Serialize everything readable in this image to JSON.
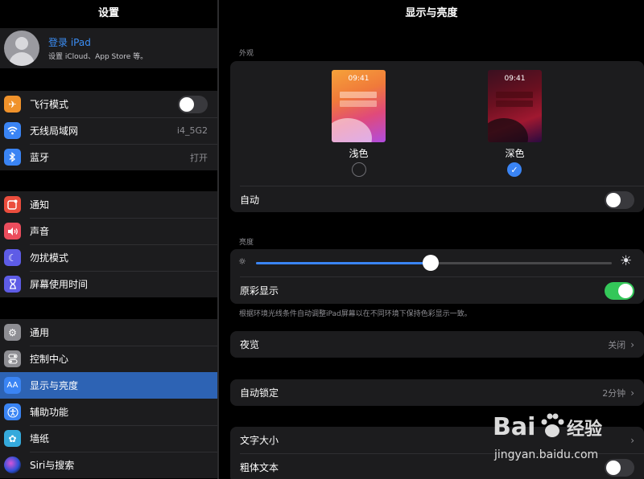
{
  "sidebar": {
    "title": "设置",
    "profile": {
      "name": "登录 iPad",
      "subtitle": "设置 iCloud、App Store 等。"
    },
    "groups": [
      {
        "items": [
          {
            "label": "飞行模式",
            "icon": "airplane-icon",
            "color": "#f0922b",
            "glyph": "✈",
            "toggle": "off"
          },
          {
            "label": "无线局域网",
            "icon": "wifi-icon",
            "color": "#3a84f4",
            "glyph": "◠",
            "value": "i4_5G2"
          },
          {
            "label": "蓝牙",
            "icon": "bluetooth-icon",
            "color": "#3a84f4",
            "glyph": "ᛒ",
            "value": "打开"
          }
        ]
      },
      {
        "items": [
          {
            "label": "通知",
            "icon": "notifications-icon",
            "color": "#eb4d3d",
            "glyph": "◘"
          },
          {
            "label": "声音",
            "icon": "sound-icon",
            "color": "#eb4d5d",
            "glyph": "🔊"
          },
          {
            "label": "勿扰模式",
            "icon": "moon-icon",
            "color": "#5e5ce6",
            "glyph": "☾"
          },
          {
            "label": "屏幕使用时间",
            "icon": "hourglass-icon",
            "color": "#5e5ce6",
            "glyph": "⧗"
          }
        ]
      },
      {
        "items": [
          {
            "label": "通用",
            "icon": "gear-icon",
            "color": "#8e8e93",
            "glyph": "⚙"
          },
          {
            "label": "控制中心",
            "icon": "control-center-icon",
            "color": "#8e8e93",
            "glyph": "◉"
          },
          {
            "label": "显示与亮度",
            "icon": "display-icon",
            "color": "#3a84f4",
            "glyph": "AA",
            "selected": true
          },
          {
            "label": "辅助功能",
            "icon": "accessibility-icon",
            "color": "#3a84f4",
            "glyph": "♿"
          },
          {
            "label": "墙纸",
            "icon": "wallpaper-icon",
            "color": "#35aadc",
            "glyph": "✿"
          },
          {
            "label": "Siri与搜索",
            "icon": "siri-icon",
            "color": "#333344",
            "glyph": "◍"
          }
        ]
      }
    ]
  },
  "main": {
    "title": "显示与亮度",
    "appearance": {
      "section_label": "外观",
      "light": {
        "time": "09:41",
        "label": "浅色",
        "selected": false
      },
      "dark": {
        "time": "09:41",
        "label": "深色",
        "selected": true
      },
      "auto_label": "自动",
      "auto_on": false
    },
    "brightness": {
      "section_label": "亮度",
      "level": 0.49,
      "true_tone_label": "原彩显示",
      "true_tone_on": true,
      "footnote": "根据环境光线条件自动调整iPad屏幕以在不同环境下保持色彩显示一致。"
    },
    "night_shift": {
      "label": "夜览",
      "value": "关闭"
    },
    "auto_lock": {
      "label": "自动锁定",
      "value": "2分钟"
    },
    "text": {
      "size_label": "文字大小",
      "bold_label": "粗体文本"
    }
  },
  "watermark": {
    "brand": "Bai",
    "suffix": "经验",
    "url": "jingyan.baidu.com"
  },
  "colors": {
    "accent": "#3a84f4",
    "green": "#34c759",
    "selected_row": "#2d63b4"
  }
}
